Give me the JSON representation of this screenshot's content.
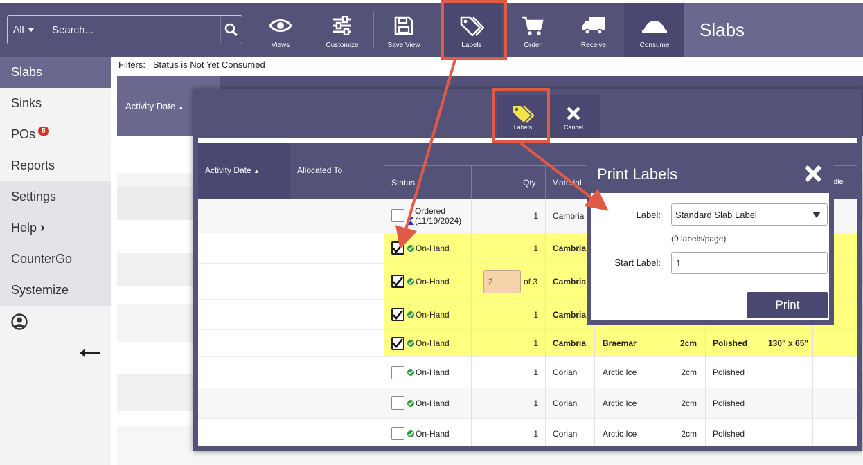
{
  "search": {
    "scope": "All",
    "placeholder": "Search..."
  },
  "toolbar": {
    "views": "Views",
    "customize": "Customize",
    "save_view": "Save View",
    "labels": "Labels",
    "order": "Order",
    "receive": "Receive",
    "consume": "Consume"
  },
  "page_title": "Slabs",
  "sidebar": {
    "items": [
      {
        "label": "Slabs",
        "active": true
      },
      {
        "label": "Sinks"
      },
      {
        "label": "POs",
        "badge": "5"
      },
      {
        "label": "Reports"
      },
      {
        "label": "Settings"
      },
      {
        "label": "Help",
        "chevron": "›"
      },
      {
        "label": "CounterGo"
      },
      {
        "label": "Systemize"
      }
    ],
    "collapse_icon": "arrow-left-icon"
  },
  "filters": {
    "prefix": "Filters:",
    "text": "Status is Not Yet Consumed"
  },
  "background": {
    "activity_date_header": "Activity Date"
  },
  "panel": {
    "labels_button": "Labels",
    "cancel_button": "Cancel",
    "columns": {
      "activity_date": "Activity Date",
      "allocated_to": "Allocated To",
      "status": "Status",
      "qty": "Qty",
      "material": "Material",
      "edge": "dle"
    },
    "rows": [
      {
        "checked": false,
        "status_line1": "Ordered",
        "status_line2": "(11/19/2024)",
        "qty": "1",
        "material": "Cambria",
        "color": "",
        "thickness": "",
        "finish": "",
        "size": "",
        "highlight": false
      },
      {
        "checked": true,
        "status": "On-Hand",
        "qty": "1",
        "material": "Cambria",
        "color": "",
        "thickness": "",
        "finish": "",
        "size": "",
        "highlight": true
      },
      {
        "checked": true,
        "status": "On-Hand",
        "qty_input": "2",
        "qty_of": "of 3",
        "material": "Cambria",
        "color": "",
        "thickness": "",
        "finish": "",
        "size": "",
        "highlight": true
      },
      {
        "checked": true,
        "status": "On-Hand",
        "qty": "1",
        "material": "Cambria",
        "color": "",
        "thickness": "",
        "finish": "",
        "size": "",
        "highlight": true
      },
      {
        "checked": true,
        "status": "On-Hand",
        "qty": "1",
        "material": "Cambria",
        "color": "Braemar",
        "thickness": "2cm",
        "finish": "Polished",
        "size": "130\" x 65\"",
        "highlight": true
      },
      {
        "checked": false,
        "status": "On-Hand",
        "qty": "1",
        "material": "Corian",
        "color": "Arctic Ice",
        "thickness": "2cm",
        "finish": "Polished",
        "size": "",
        "highlight": false
      },
      {
        "checked": false,
        "status": "On-Hand",
        "qty": "1",
        "material": "Corian",
        "color": "Arctic Ice",
        "thickness": "2cm",
        "finish": "Polished",
        "size": "",
        "highlight": false
      },
      {
        "checked": false,
        "status": "On-Hand",
        "qty": "1",
        "material": "Corian",
        "color": "Arctic Ice",
        "thickness": "2cm",
        "finish": "Polished",
        "size": "",
        "highlight": false
      }
    ]
  },
  "dialog": {
    "title": "Print Labels",
    "label_caption": "Label:",
    "label_value": "Standard Slab Label",
    "per_page": "(9 labels/page)",
    "start_caption": "Start Label:",
    "start_value": "1",
    "print_button": "Print"
  },
  "colors": {
    "header": "#55527a",
    "accent": "#6b6890",
    "highlight": "#ffff80",
    "callout": "#e05a45",
    "badge": "#d0342c"
  }
}
